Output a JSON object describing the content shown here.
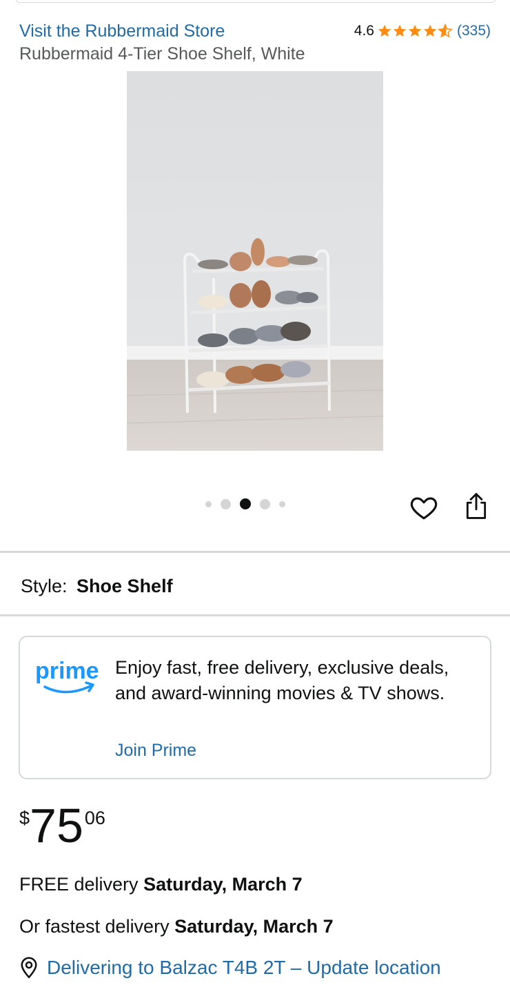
{
  "header": {
    "store_link": "Visit the Rubbermaid Store",
    "rating_value": "4.6",
    "rating_stars": 4.6,
    "rating_count": "(335)",
    "star_color": "#ff8c12"
  },
  "product": {
    "title": "Rubbermaid 4-Tier Shoe Shelf, White",
    "image_icon": "white-four-tier-shoe-shelf-photo"
  },
  "carousel": {
    "dot_count": 5,
    "active_index": 2
  },
  "actions": {
    "wishlist_icon": "heart-outline-icon",
    "share_icon": "share-icon"
  },
  "style": {
    "label": "Style:",
    "value": "Shoe Shelf"
  },
  "prime": {
    "logo_text": "prime",
    "logo_color": "#1a98ff",
    "description": "Enjoy fast, free delivery, exclusive deals, and award-winning movies & TV shows.",
    "join_link": "Join Prime"
  },
  "price": {
    "symbol": "$",
    "whole": "75",
    "fraction": "06"
  },
  "delivery": {
    "free_prefix": "FREE delivery",
    "free_date": "Saturday, March 7",
    "fast_prefix": "Or fastest delivery",
    "fast_date": "Saturday, March 7"
  },
  "location": {
    "icon": "location-pin-icon",
    "text": "Delivering to Balzac T4B 2T – Update location"
  },
  "colors": {
    "link": "#1e6ba8",
    "text": "#0f1111",
    "muted": "#565959",
    "divider": "#d5d9d9"
  }
}
